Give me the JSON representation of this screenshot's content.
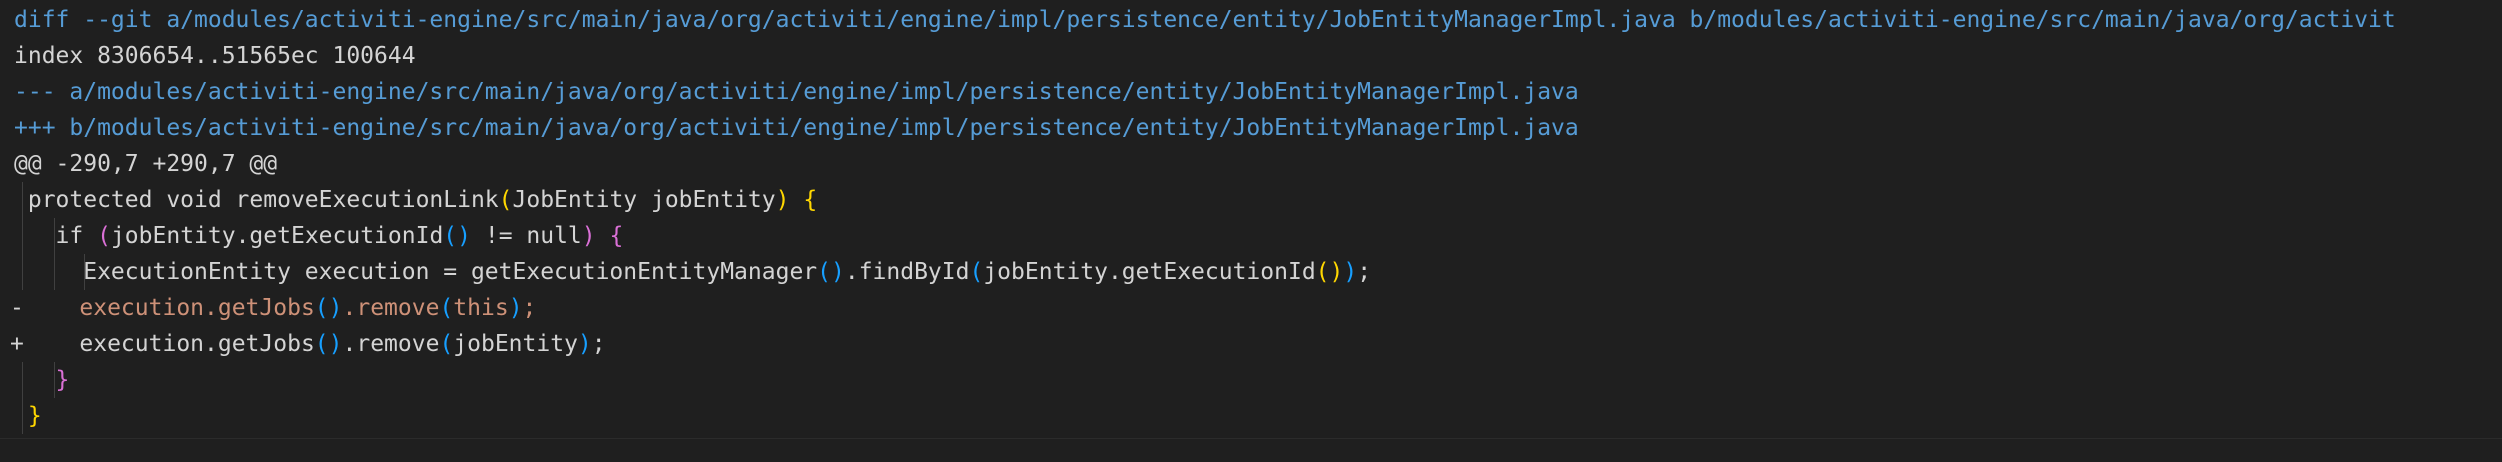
{
  "diff": {
    "header_git": "diff --git a/modules/activiti-engine/src/main/java/org/activiti/engine/impl/persistence/entity/JobEntityManagerImpl.java b/modules/activiti-engine/src/main/java/org/activit",
    "header_index": "index 8306654..51565ec 100644",
    "header_old": "--- a/modules/activiti-engine/src/main/java/org/activiti/engine/impl/persistence/entity/JobEntityManagerImpl.java",
    "header_new": "+++ b/modules/activiti-engine/src/main/java/org/activiti/engine/impl/persistence/entity/JobEntityManagerImpl.java",
    "hunk": "@@ -290,7 +290,7 @@"
  },
  "code": {
    "l1_text": " protected void removeExecutionLink",
    "l1_paren_open": "(",
    "l1_args": "JobEntity jobEntity",
    "l1_paren_close": ")",
    "l1_brace": " {",
    "l2_prefix": "   if ",
    "l2_paren_open": "(",
    "l2_call": "jobEntity.getExecutionId",
    "l2_inner_parens": "()",
    "l2_rest": " != null",
    "l2_paren_close": ")",
    "l2_brace": " {",
    "l3_prefix": "     ExecutionEntity execution = getExecutionEntityManager",
    "l3_p1": "()",
    "l3_mid": ".findById",
    "l3_p2_open": "(",
    "l3_arg": "jobEntity.getExecutionId",
    "l3_p3": "()",
    "l3_p2_close": ")",
    "l3_end": ";",
    "l4_sign": "-",
    "l4_prefix": "    execution.getJobs",
    "l4_p1": "()",
    "l4_mid": ".remove",
    "l4_p2_open": "(",
    "l4_arg": "this",
    "l4_p2_close": ")",
    "l4_end": ";",
    "l5_sign": "+",
    "l5_prefix": "    execution.getJobs",
    "l5_p1": "()",
    "l5_mid": ".remove",
    "l5_p2_open": "(",
    "l5_arg": "jobEntity",
    "l5_p2_close": ")",
    "l5_end": ";",
    "l6_brace": "   }",
    "l7_brace": " }"
  }
}
